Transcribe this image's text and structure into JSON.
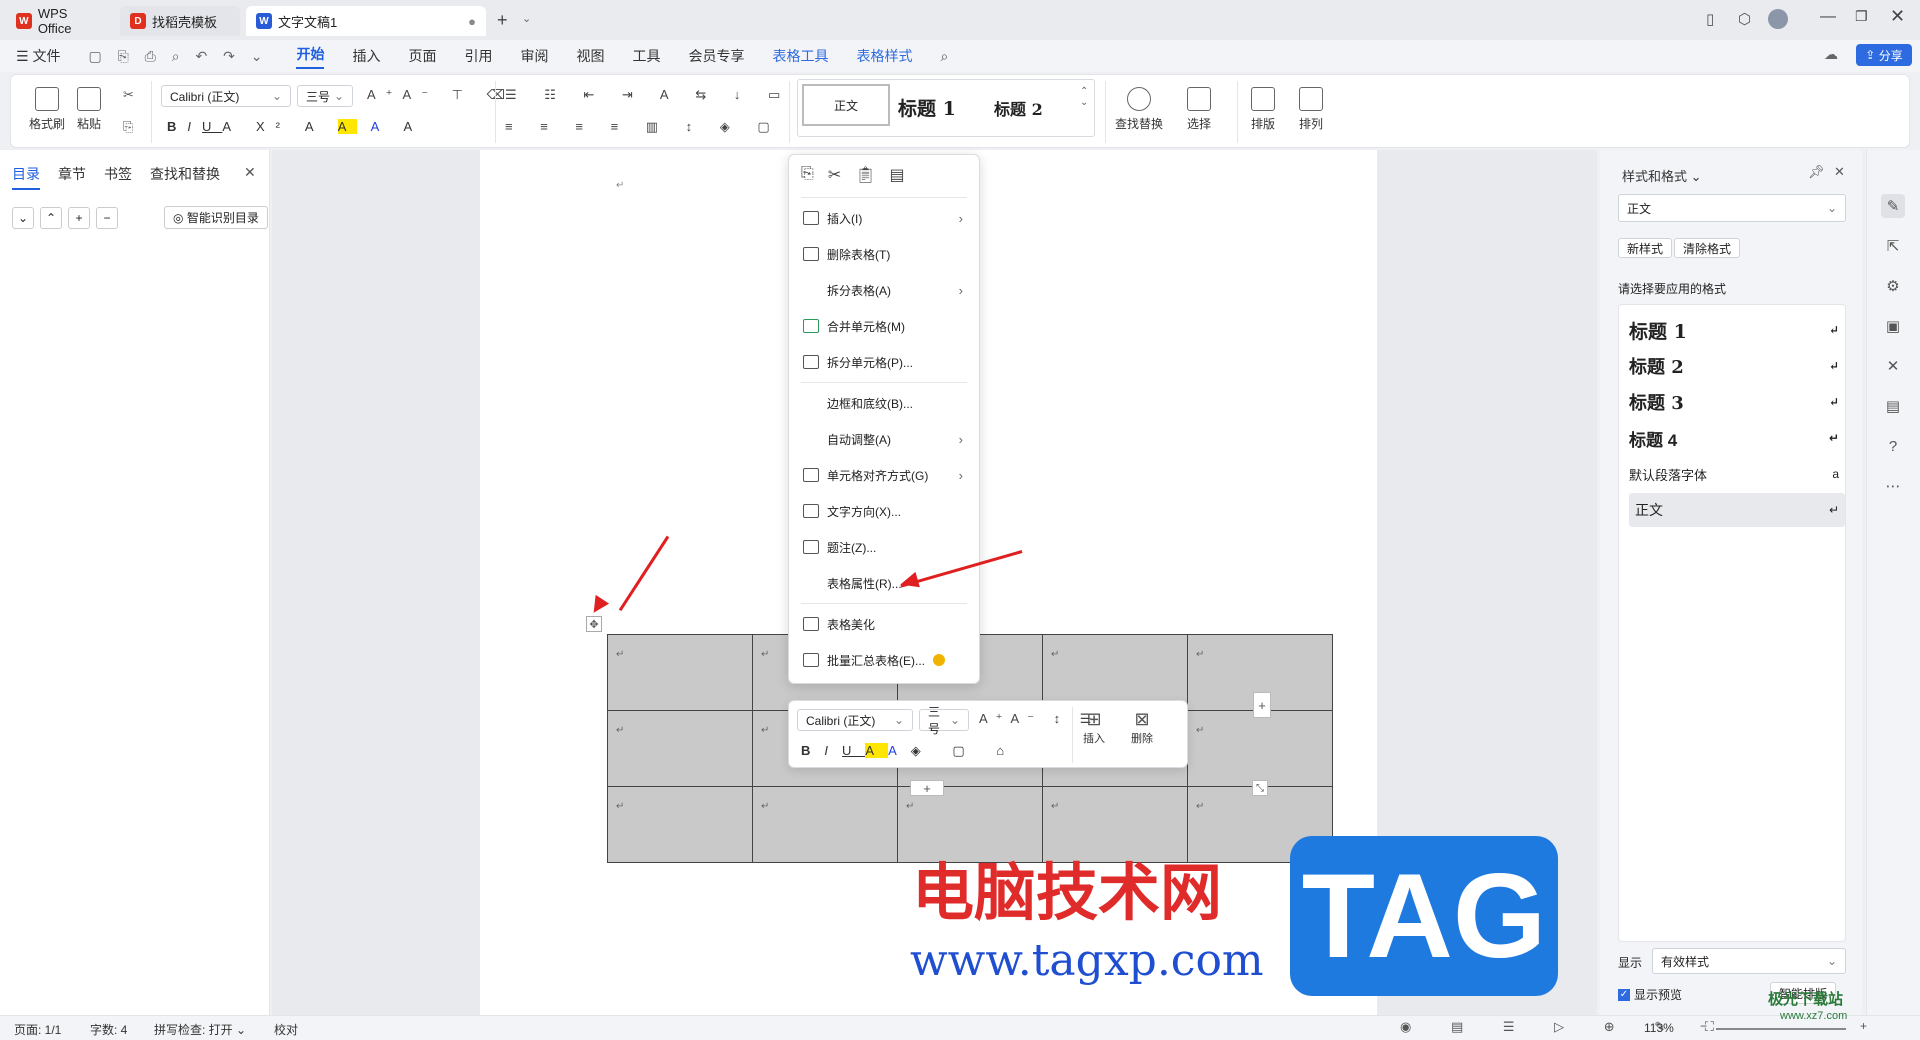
{
  "tabs": [
    {
      "label": "WPS Office",
      "color": "#e0301e"
    },
    {
      "label": "找稻壳模板",
      "color": "#e0301e"
    },
    {
      "label": "文字文稿1",
      "color": "#2a5bd7"
    }
  ],
  "menu": {
    "file": "文件",
    "items": [
      "开始",
      "插入",
      "页面",
      "引用",
      "审阅",
      "视图",
      "工具",
      "会员专享"
    ],
    "active": "开始",
    "context_items": [
      "表格工具",
      "表格样式"
    ],
    "share": "分享"
  },
  "ribbon": {
    "format_painter": "格式刷",
    "paste": "粘贴",
    "font": "Calibri (正文)",
    "font_size": "三号",
    "styles": [
      "正文",
      "标题 1",
      "标题 2"
    ],
    "find_replace": "查找替换",
    "select": "选择",
    "layout": "排版",
    "arrange": "排列"
  },
  "leftnav": {
    "tabs": [
      "目录",
      "章节",
      "书签",
      "查找和替换"
    ],
    "active": "目录",
    "smart_toc": "智能识别目录"
  },
  "context_menu": {
    "items": [
      {
        "label": "插入(I)",
        "submenu": true
      },
      {
        "label": "删除表格(T)",
        "submenu": false
      },
      {
        "label": "拆分表格(A)",
        "submenu": true
      },
      {
        "label": "合并单元格(M)",
        "submenu": false
      },
      {
        "label": "拆分单元格(P)...",
        "submenu": false
      },
      {
        "label": "边框和底纹(B)...",
        "submenu": false
      },
      {
        "label": "自动调整(A)",
        "submenu": true
      },
      {
        "label": "单元格对齐方式(G)",
        "submenu": true
      },
      {
        "label": "文字方向(X)...",
        "submenu": false
      },
      {
        "label": "题注(Z)...",
        "submenu": false
      },
      {
        "label": "表格属性(R)...",
        "submenu": false
      },
      {
        "label": "表格美化",
        "submenu": false
      },
      {
        "label": "批量汇总表格(E)...",
        "submenu": false
      }
    ]
  },
  "mini_toolbar": {
    "font": "Calibri (正文)",
    "size": "三号",
    "insert": "插入",
    "delete": "删除"
  },
  "right_panel": {
    "title": "样式和格式",
    "current_style": "正文",
    "new_style": "新样式",
    "clear_format": "清除格式",
    "prompt": "请选择要应用的格式",
    "styles": [
      "标题 1",
      "标题 2",
      "标题 3",
      "标题 4",
      "默认段落字体",
      "正文"
    ],
    "show_label": "显示",
    "show_value": "有效样式",
    "preview": "显示预览",
    "smart_layout": "智能排版"
  },
  "status": {
    "page": "页面: 1/1",
    "words": "字数: 4",
    "spell": "拼写检查: 打开",
    "proof": "校对",
    "zoom": "113%"
  },
  "watermark": {
    "site_cn": "电脑技术网",
    "site_url": "www.tagxp.com",
    "tag": "TAG",
    "corner": "极光下载站",
    "corner_url": "www.xz7.com"
  }
}
